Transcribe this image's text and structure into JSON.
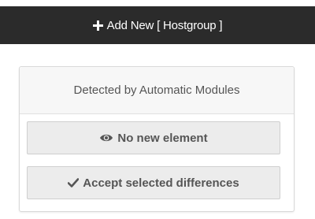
{
  "header": {
    "add_label": "Add New [ Hostgroup ]",
    "add_icon": "plus-icon"
  },
  "panel": {
    "title": "Detected by Automatic Modules",
    "buttons": [
      {
        "label": "No new element",
        "icon": "eye-icon"
      },
      {
        "label": "Accept selected differences",
        "icon": "checkmark-icon"
      }
    ]
  },
  "colors": {
    "header_bg": "#2b2b2b",
    "header_text": "#ffffff",
    "panel_text": "#555555",
    "button_bg": "#ececec"
  }
}
